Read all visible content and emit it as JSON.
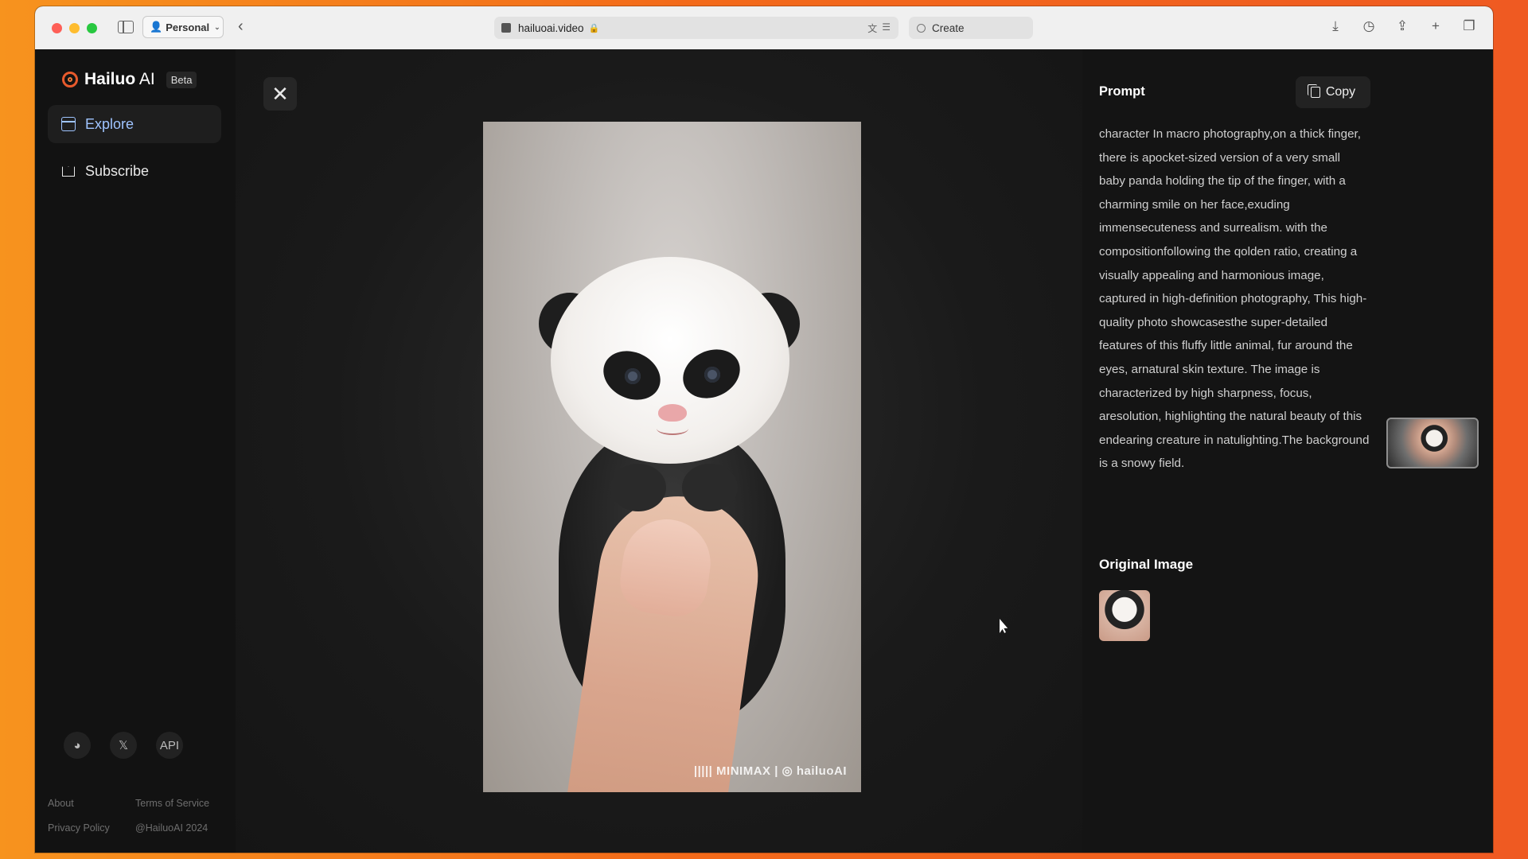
{
  "browser": {
    "profile_label": "Personal",
    "url": "hailuoai.video",
    "second_tab_label": "Create"
  },
  "app": {
    "name_bold": "Hailuo",
    "name_light": "AI",
    "badge": "Beta",
    "accent_color": "#9fc4ff"
  },
  "nav": {
    "items": [
      {
        "label": "Explore",
        "icon": "calendar-icon",
        "active": true
      },
      {
        "label": "Subscribe",
        "icon": "crown-icon",
        "active": false
      }
    ]
  },
  "social": {
    "discord": "discord-icon",
    "x": "𝕏",
    "api": "API"
  },
  "footer": {
    "about": "About",
    "terms": "Terms of Service",
    "privacy": "Privacy Policy",
    "handle": "@HailuoAI 2024"
  },
  "viewer": {
    "close_symbol": "✕",
    "watermark": "||||| MINIMAX | ◎ hailuoAI"
  },
  "prompt": {
    "title": "Prompt",
    "copy_label": "Copy",
    "text": "character In macro photography,on a thick finger, there is apocket-sized version of a very small baby panda holding the tip of the finger, with a charming smile on her face,exuding immensecuteness and surrealism. with the compositionfollowing the qolden ratio, creating a visually appealing and harmonious image, captured in high-definition photography, This high-quality photo showcasesthe super-detailed features of this fluffy little animal, fur around the eyes, arnatural skin texture. The image is characterized by high sharpness, focus, aresolution, highlighting the natural beauty of this endearing creature in natulighting.The background is a snowy field."
  },
  "original_image": {
    "title": "Original Image"
  }
}
